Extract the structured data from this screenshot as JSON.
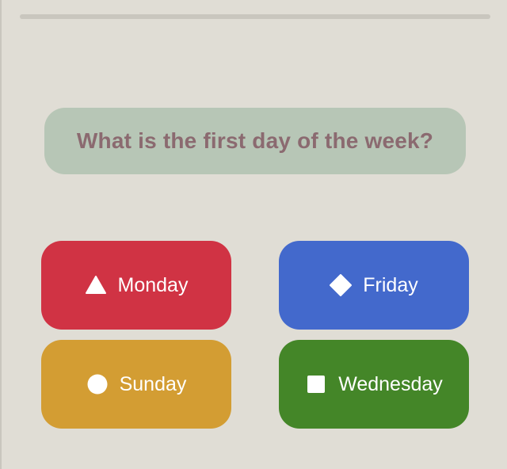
{
  "progress": {
    "fraction": 0
  },
  "question": {
    "text": "What is the first day of the week?"
  },
  "answers": [
    {
      "label": "Monday",
      "shape": "triangle-icon",
      "color": "#d03344"
    },
    {
      "label": "Friday",
      "shape": "diamond-icon",
      "color": "#4369cc"
    },
    {
      "label": "Sunday",
      "shape": "circle-icon",
      "color": "#d39d33"
    },
    {
      "label": "Wednesday",
      "shape": "square-icon",
      "color": "#448628"
    }
  ],
  "colors": {
    "background": "#e0ddd5",
    "question_card": "#b7c6b6",
    "question_text": "#8b6a70"
  }
}
